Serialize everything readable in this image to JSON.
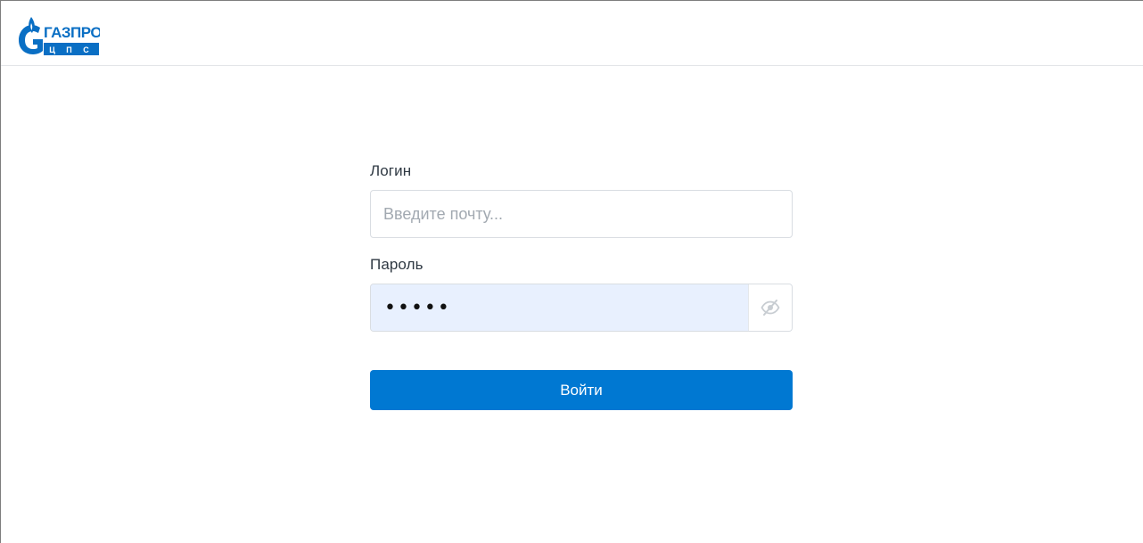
{
  "header": {
    "logo": {
      "brand": "ГАЗПРОМ",
      "sub": "Ц П С",
      "color": "#0a6fc4"
    }
  },
  "form": {
    "login": {
      "label": "Логин",
      "placeholder": "Введите почту...",
      "value": ""
    },
    "password": {
      "label": "Пароль",
      "masked_value": "•••••",
      "toggle_icon": "eye-off-icon"
    },
    "submit_label": "Войти"
  },
  "colors": {
    "primary": "#0078d2",
    "autofill_bg": "#e8f0fe",
    "border": "#d9dde2",
    "label_text": "#2f3943"
  }
}
